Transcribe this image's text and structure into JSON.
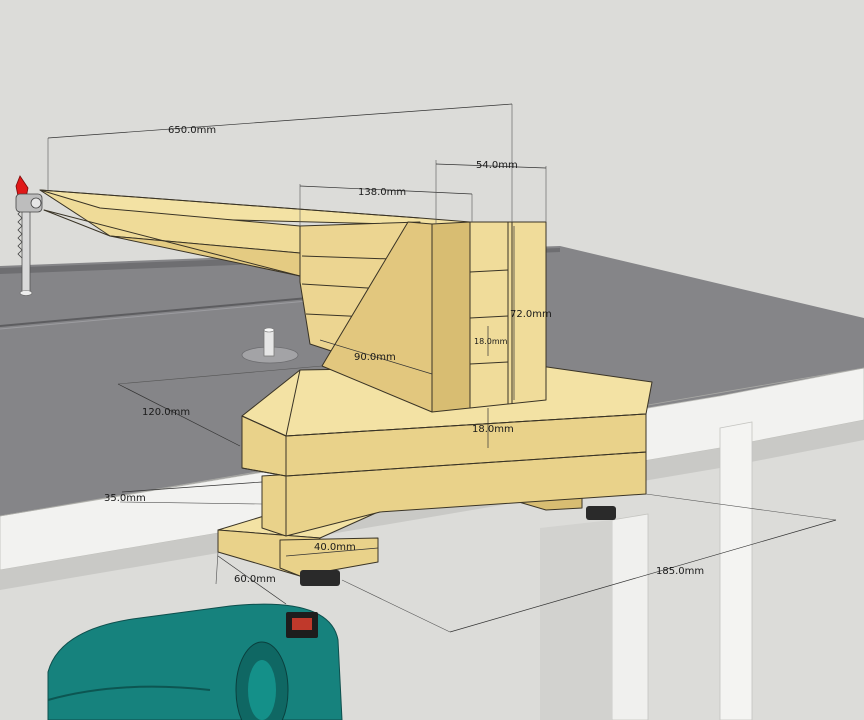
{
  "dimensions": {
    "arm_length": "650.0mm",
    "top_offset": "138.0mm",
    "block_width": "54.0mm",
    "block_height": "72.0mm",
    "block_layer": "18.0mm",
    "brace": "90.0mm",
    "reach": "120.0mm",
    "base_layer": "18.0mm",
    "edge_offset": "35.0mm",
    "foot_width": "40.0mm",
    "foot_depth": "60.0mm",
    "base_length": "185.0mm"
  },
  "colors": {
    "background": "#dcdcd9",
    "wood_top": "#f3e2a4",
    "wood_front": "#e9d28a",
    "wood_side": "#d8bd72",
    "table_top": "#858588",
    "table_edge": "#f1f1ef",
    "tool_body": "#16827d",
    "tool_dark": "#0e4f4d",
    "blade_tip": "#e01818"
  }
}
